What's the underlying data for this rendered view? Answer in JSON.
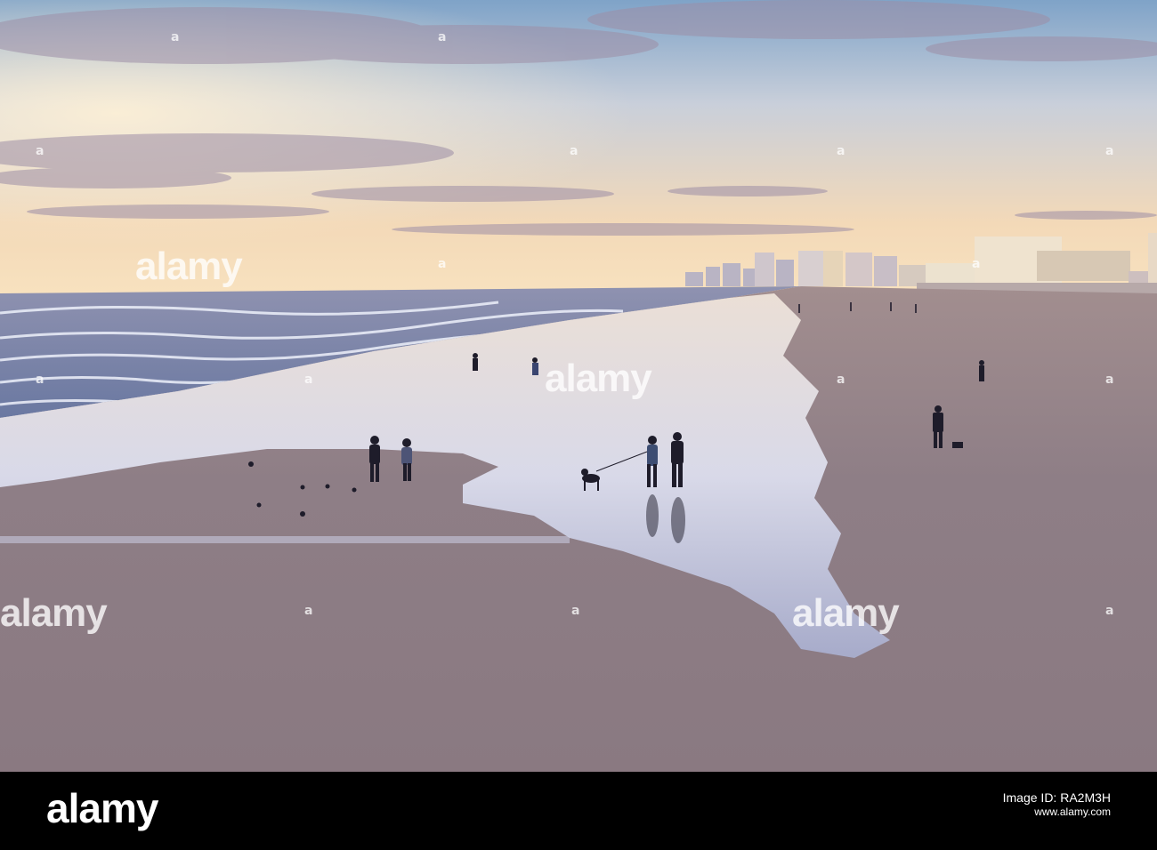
{
  "watermark": {
    "word": "alamy",
    "mark": "a"
  },
  "footer": {
    "logo": "alamy",
    "line1": "Image ID: RA2M3H",
    "line2": "www.alamy.com"
  },
  "colors": {
    "sky_top": "#7fa3c8",
    "sky_horizon": "#f6dcb5",
    "ocean": "#6c7fa8",
    "sand": "#8f7f86",
    "wet_sand_reflection": "#dfe3f3",
    "footer": "#000000"
  }
}
